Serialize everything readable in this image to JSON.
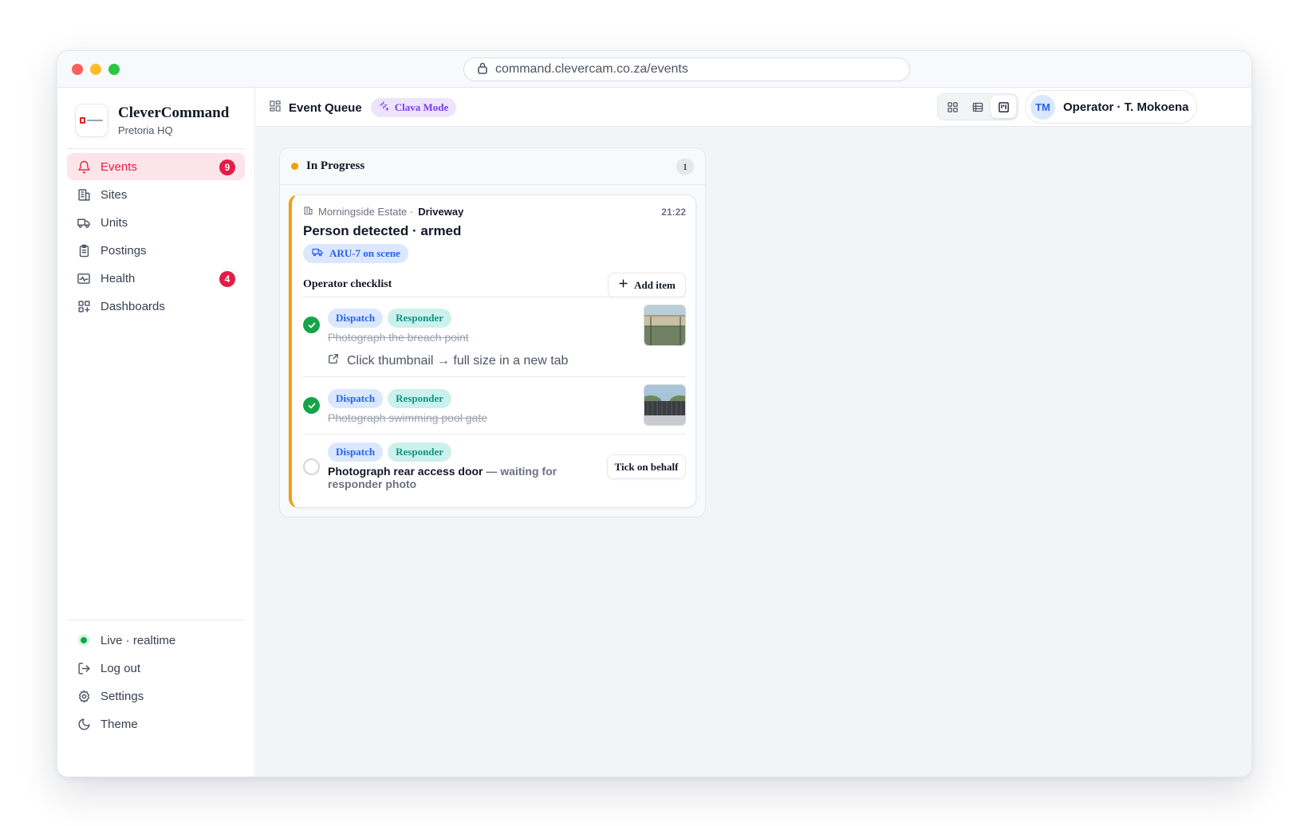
{
  "browser": {
    "url": "command.clevercam.co.za/events"
  },
  "brand": {
    "name": "CleverCommand",
    "site": "Pretoria HQ"
  },
  "sidebar": {
    "items": [
      {
        "label": "Events",
        "icon": "bell-icon",
        "badge": "9",
        "active": true
      },
      {
        "label": "Sites",
        "icon": "building-icon"
      },
      {
        "label": "Units",
        "icon": "truck-icon"
      },
      {
        "label": "Postings",
        "icon": "clipboard-icon"
      },
      {
        "label": "Health",
        "icon": "pulse-icon",
        "badge": "4"
      },
      {
        "label": "Dashboards",
        "icon": "dashboard-icon"
      }
    ],
    "bottom": [
      {
        "label": "Live · realtime",
        "icon": "status-dot"
      },
      {
        "label": "Log out",
        "icon": "logout-icon"
      },
      {
        "label": "Settings",
        "icon": "gear-icon"
      },
      {
        "label": "Theme",
        "icon": "moon-icon"
      }
    ]
  },
  "header": {
    "title": "Event Queue",
    "mode_label": "Clava Mode",
    "view_modes": [
      "grid",
      "list",
      "board"
    ],
    "active_view": "board",
    "operator_initials": "TM",
    "operator_label": "Operator · T. Mokoena"
  },
  "column": {
    "title": "In Progress",
    "count": "1",
    "status_color": "#f59e0b"
  },
  "card": {
    "site": "Morningside Estate ·",
    "zone": "Driveway",
    "time": "21:22",
    "title": "Person detected · armed",
    "unit_label": "ARU-7 on scene",
    "checklist_title": "Operator checklist",
    "add_item_label": "Add item",
    "items": [
      {
        "tags": [
          "Dispatch",
          "Responder"
        ],
        "text": "Photograph the breach point",
        "done": true,
        "hint": "Click thumbnail → full size in a new tab"
      },
      {
        "tags": [
          "Dispatch",
          "Responder"
        ],
        "text": "Photograph swimming pool gate",
        "done": true
      },
      {
        "tags": [
          "Dispatch",
          "Responder"
        ],
        "text": "Photograph rear access door",
        "note": "— waiting for responder photo",
        "done": false,
        "action_label": "Tick on behalf"
      }
    ]
  }
}
